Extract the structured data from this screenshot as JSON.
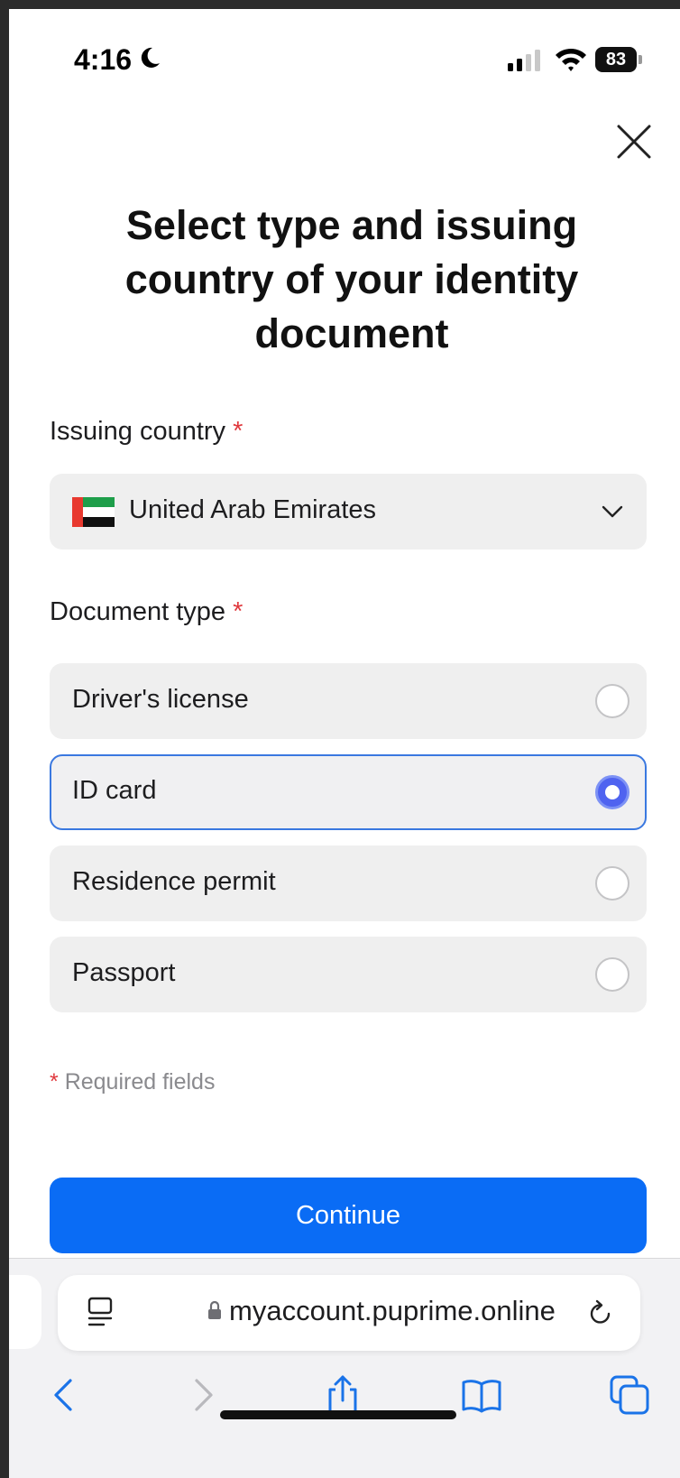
{
  "status_bar": {
    "time": "4:16",
    "battery": "83"
  },
  "title": "Select type and issuing country of your identity document",
  "issuing_country": {
    "label": "Issuing country",
    "required_marker": "*",
    "selected_value": "United Arab Emirates",
    "flag_icon": "uae-flag-icon"
  },
  "document_type": {
    "label": "Document type",
    "required_marker": "*",
    "options": [
      {
        "label": "Driver's license",
        "selected": false
      },
      {
        "label": "ID card",
        "selected": true
      },
      {
        "label": "Residence permit",
        "selected": false
      },
      {
        "label": "Passport",
        "selected": false
      }
    ]
  },
  "required_note": {
    "marker": "*",
    "text": "Required fields"
  },
  "continue_label": "Continue",
  "browser": {
    "url": "myaccount.puprime.online"
  },
  "colors": {
    "accent": "#0a6cf5",
    "radio_selected": "#4f63f0",
    "selected_border": "#3a78e0",
    "required": "#e0393e",
    "option_bg": "#efefef",
    "browser_icon": "#1a73e8"
  }
}
